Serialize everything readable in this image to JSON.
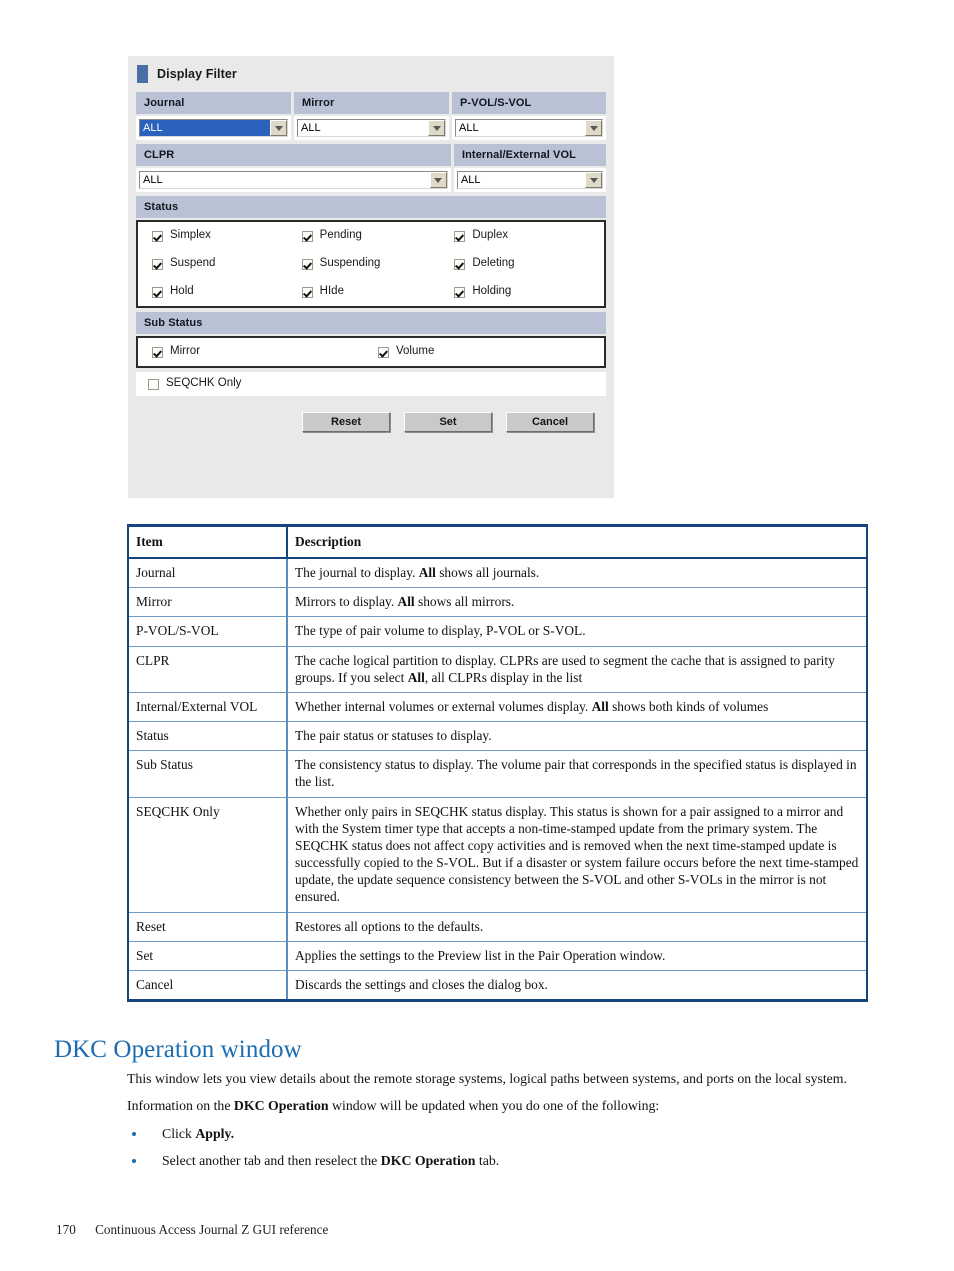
{
  "dialog": {
    "title": "Display Filter",
    "fields": [
      {
        "label": "Journal",
        "value": "ALL",
        "selected": true
      },
      {
        "label": "Mirror",
        "value": "ALL",
        "selected": false
      },
      {
        "label": "P-VOL/S-VOL",
        "value": "ALL",
        "selected": false
      },
      {
        "label": "CLPR",
        "value": "ALL",
        "selected": false
      },
      {
        "label": "Internal/External VOL",
        "value": "ALL",
        "selected": false
      }
    ],
    "status": {
      "band": "Status",
      "checkboxes": [
        {
          "label": "Simplex",
          "checked": true
        },
        {
          "label": "Pending",
          "checked": true
        },
        {
          "label": "Duplex",
          "checked": true
        },
        {
          "label": "Suspend",
          "checked": true
        },
        {
          "label": "Suspending",
          "checked": true
        },
        {
          "label": "Deleting",
          "checked": true
        },
        {
          "label": "Hold",
          "checked": true
        },
        {
          "label": "HIde",
          "checked": true
        },
        {
          "label": "Holding",
          "checked": true
        }
      ]
    },
    "sub_status": {
      "band": "Sub Status",
      "checkboxes": [
        {
          "label": "Mirror",
          "checked": true
        },
        {
          "label": "Volume",
          "checked": true
        }
      ]
    },
    "seqchk": {
      "label": "SEQCHK Only",
      "checked": false
    },
    "buttons": [
      {
        "label": "Reset"
      },
      {
        "label": "Set"
      },
      {
        "label": "Cancel"
      }
    ],
    "colors": {
      "band": "#b9c2d4",
      "selection": "#2c62bd",
      "title_marker": "#4a6fa5",
      "dialog_bg": "#e9e9e9"
    }
  },
  "table": {
    "headers": [
      "Item",
      "Description"
    ],
    "rows": [
      {
        "item": "Journal",
        "desc_html": "The journal to display. <b>All</b> shows all journals."
      },
      {
        "item": "Mirror",
        "desc_html": "Mirrors to display. <b>All</b> shows all mirrors."
      },
      {
        "item": "P-VOL/S-VOL",
        "desc_html": "The type of pair volume to display, P-VOL or S-VOL."
      },
      {
        "item": "CLPR",
        "desc_html": "The cache logical partition to display. CLPRs are used to segment the cache that is assigned to parity groups. If you select <b>All</b>, all CLPRs display in the list"
      },
      {
        "item": "Internal/External VOL",
        "desc_html": "Whether internal volumes or external volumes display. <b>All</b> shows both kinds of volumes"
      },
      {
        "item": "Status",
        "desc_html": "The pair status or statuses to display."
      },
      {
        "item": "Sub Status",
        "desc_html": "The consistency status to display. The volume pair that corresponds in the specified status is displayed in the list."
      },
      {
        "item": "SEQCHK Only",
        "desc_html": "Whether only pairs in SEQCHK status display. This status is shown for a pair assigned to a mirror and with the System timer type that accepts a non-time-stamped update from the primary system. The SEQCHK status does not affect copy activities and is removed when the next time-stamped update is successfully copied to the S-VOL. But if a disaster or system failure occurs before the next time-stamped update, the update sequence consistency between the S-VOL and other S-VOLs in the mirror is not ensured."
      },
      {
        "item": "Reset",
        "desc_html": "Restores all options to the defaults."
      },
      {
        "item": "Set",
        "desc_html": "Applies the settings to the Preview list in the Pair Operation window."
      },
      {
        "item": "Cancel",
        "desc_html": "Discards the settings and closes the dialog box."
      }
    ]
  },
  "section": {
    "heading": "DKC Operation window",
    "paragraphs": [
      "This window lets you view details about the remote storage systems, logical paths between systems, and ports on the local system.",
      "Information on the <b>DKC Operation</b> window will be updated when you do one of the following:"
    ],
    "bullets": [
      "Click <b>Apply.</b>",
      "Select another tab and then reselect the <b>DKC Operation</b> tab."
    ]
  },
  "footer": {
    "page_number": "170",
    "text": "Continuous Access Journal Z GUI reference"
  }
}
